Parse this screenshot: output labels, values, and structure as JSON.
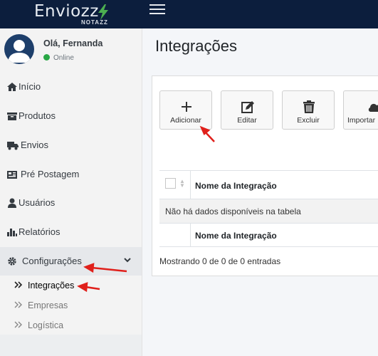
{
  "brand": {
    "name": "Enviozz",
    "subtitle": "NOTAZZ"
  },
  "user": {
    "greeting": "Olá, Fernanda",
    "status": "Online"
  },
  "sidebar": {
    "items": [
      {
        "label": "Início",
        "icon": "home-icon"
      },
      {
        "label": "Produtos",
        "icon": "box-icon"
      },
      {
        "label": "Envios",
        "icon": "truck-icon"
      },
      {
        "label": "Pré Postagem",
        "icon": "barcode-icon"
      },
      {
        "label": "Usuários",
        "icon": "user-icon"
      },
      {
        "label": "Relatórios",
        "icon": "bar-chart-icon"
      },
      {
        "label": "Configurações",
        "icon": "gear-icon"
      }
    ],
    "subitems": [
      {
        "label": "Integrações"
      },
      {
        "label": "Empresas"
      },
      {
        "label": "Logística"
      }
    ]
  },
  "page": {
    "title": "Integrações"
  },
  "toolbar": {
    "add": "Adicionar",
    "edit": "Editar",
    "delete": "Excluir",
    "import": "Importar"
  },
  "table": {
    "header": "Nome da Integração",
    "empty": "Não há dados disponíveis na tabela",
    "footer_header": "Nome da Integração",
    "info": "Mostrando 0 de 0 de 0 entradas"
  },
  "colors": {
    "topbar": "#0c1e3d",
    "accent_bolt": "#4caf50",
    "annotation": "#e0201b",
    "status": "#28a745"
  }
}
